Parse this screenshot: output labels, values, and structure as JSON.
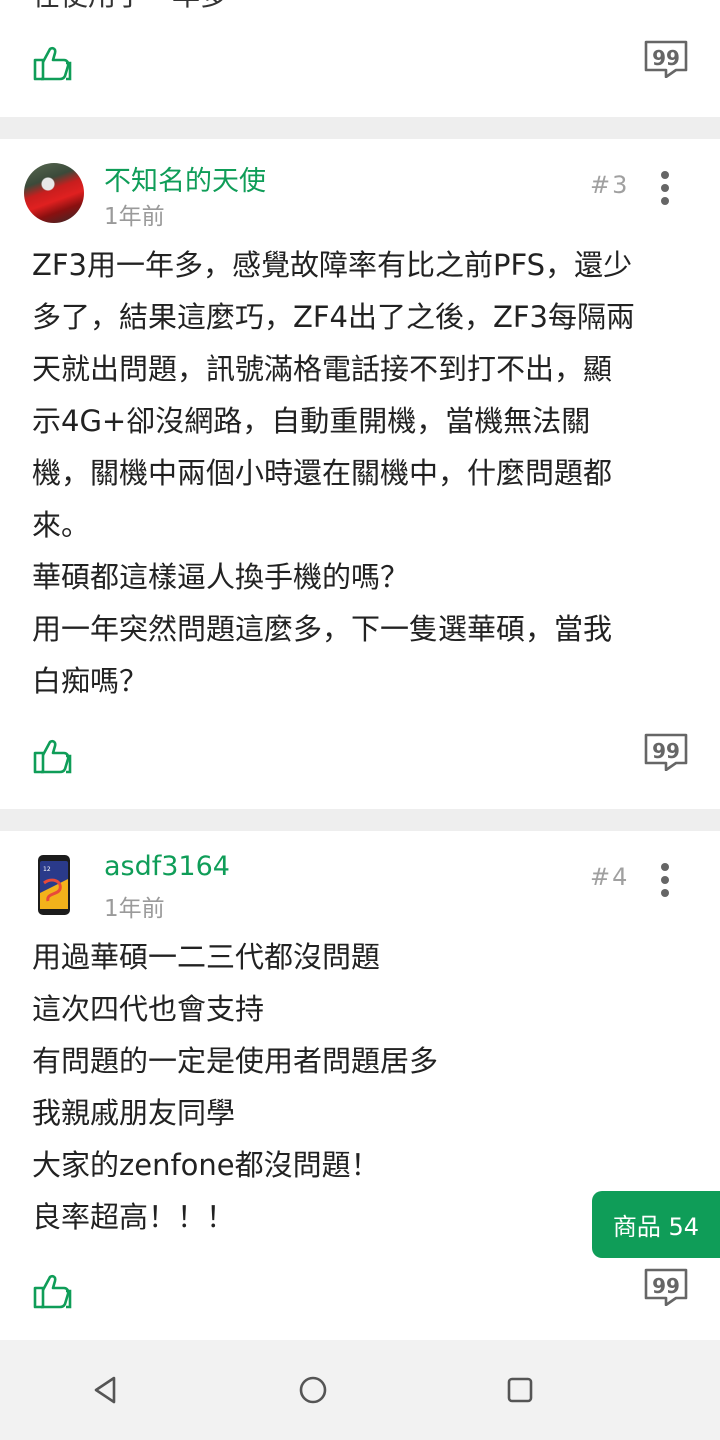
{
  "previous_post": {
    "cut_text": "在使用了一年多"
  },
  "posts": [
    {
      "username": "不知名的天使",
      "time": "1年前",
      "floor": "#3",
      "body": "ZF3用一年多，感覺故障率有比之前PFS，還少\n多了，結果這麼巧，ZF4出了之後，ZF3每隔兩\n天就出問題，訊號滿格電話接不到打不出，顯\n示4G+卻沒網路，自動重開機，當機無法關\n機，關機中兩個小時還在關機中，什麼問題都\n來。\n華碩都這樣逼人換手機的嗎？\n用一年突然問題這麼多，下一隻選華碩，當我\n白痴嗎？"
    },
    {
      "username": "asdf3164",
      "time": "1年前",
      "floor": "#4",
      "body": "用過華碩一二三代都沒問題\n這次四代也會支持\n有問題的一定是使用者問題居多\n我親戚朋友同學\n大家的zenfone都沒問題！\n良率超高！！！"
    }
  ],
  "product_button": {
    "label": "商品 54"
  },
  "colors": {
    "accent": "#0f9d58",
    "separator": "#eeeeee",
    "navbar": "#f2f2f2"
  },
  "icons": {
    "like": "thumbs-up-icon",
    "reply": "quote-reply-icon",
    "more": "more-vertical-icon",
    "nav_back": "triangle-back-icon",
    "nav_home": "circle-home-icon",
    "nav_recent": "square-recent-icon"
  }
}
